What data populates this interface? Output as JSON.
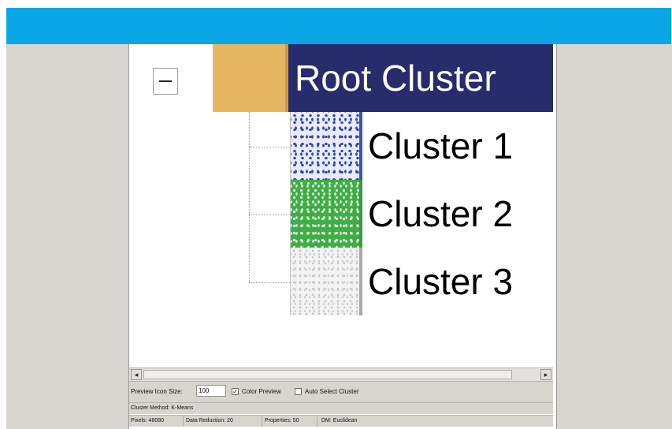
{
  "tree": {
    "root_label": "Root Cluster",
    "root_color": "#e7b661",
    "header_color": "#262d6a",
    "clusters": [
      {
        "label": "Cluster 1",
        "color": "#2f47b6"
      },
      {
        "label": "Cluster 2",
        "color": "#3fae48"
      },
      {
        "label": "Cluster 3",
        "color": "#c4c4c4"
      }
    ]
  },
  "scrollbar": {
    "left_arrow": "◂",
    "right_arrow": "▸"
  },
  "controls": {
    "icon_size_label": "Preview Icon Size:",
    "icon_size_value": "100",
    "color_preview_label": "Color Preview",
    "color_preview_checked": true,
    "auto_select_label": "Auto Select Cluster",
    "auto_select_checked": false
  },
  "status": {
    "method": "Cluster Method: K-Means",
    "pixels": "Pixels: 48080",
    "data_reduction": "Data Reduction: 20",
    "properties": "Properties: 50",
    "dm": "DM: Euclidean"
  },
  "theme": {
    "titlebar_color": "#0aa6e6",
    "window_bg": "#d8d5cf"
  }
}
